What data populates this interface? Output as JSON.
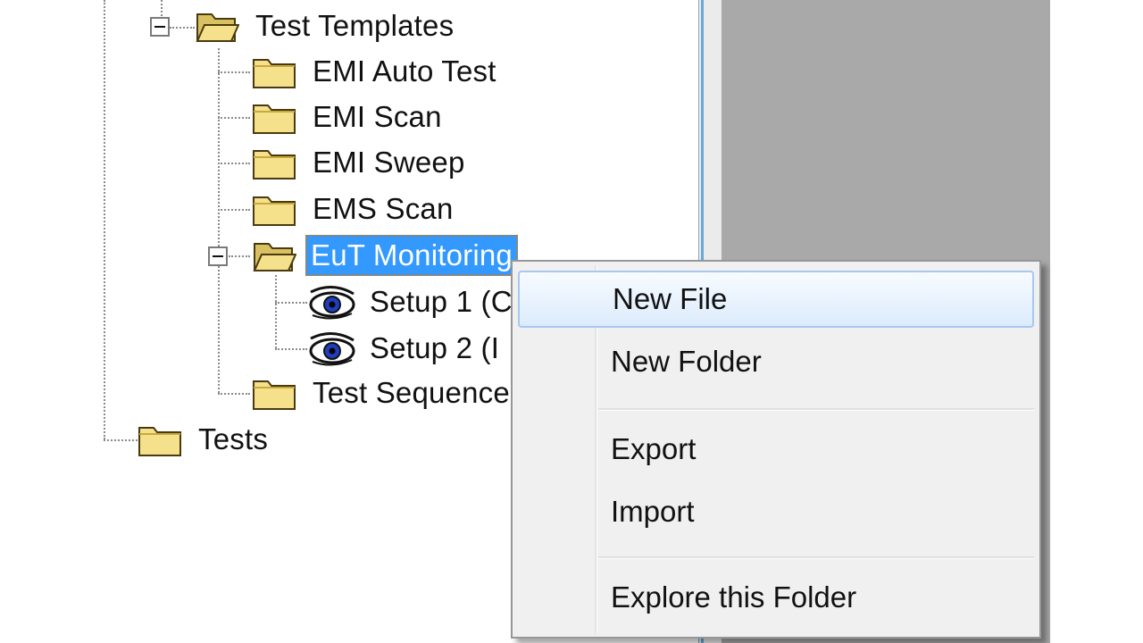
{
  "tree": {
    "nodes": [
      {
        "label": "Test Templates"
      },
      {
        "label": "EMI Auto Test"
      },
      {
        "label": "EMI Scan"
      },
      {
        "label": "EMI Sweep"
      },
      {
        "label": "EMS Scan"
      },
      {
        "label": "EuT Monitoring"
      },
      {
        "label": "Setup 1 (C"
      },
      {
        "label": "Setup 2 (I"
      },
      {
        "label": "Test Sequence"
      },
      {
        "label": "Tests"
      }
    ]
  },
  "context_menu": {
    "items": [
      {
        "label": "New File"
      },
      {
        "label": "New Folder"
      },
      {
        "label": "Export"
      },
      {
        "label": "Import"
      },
      {
        "label": "Explore this Folder"
      }
    ]
  },
  "colors": {
    "selection": "#3399ff",
    "folder": "#f5e08c",
    "right_pane": "#a9a9a9"
  }
}
